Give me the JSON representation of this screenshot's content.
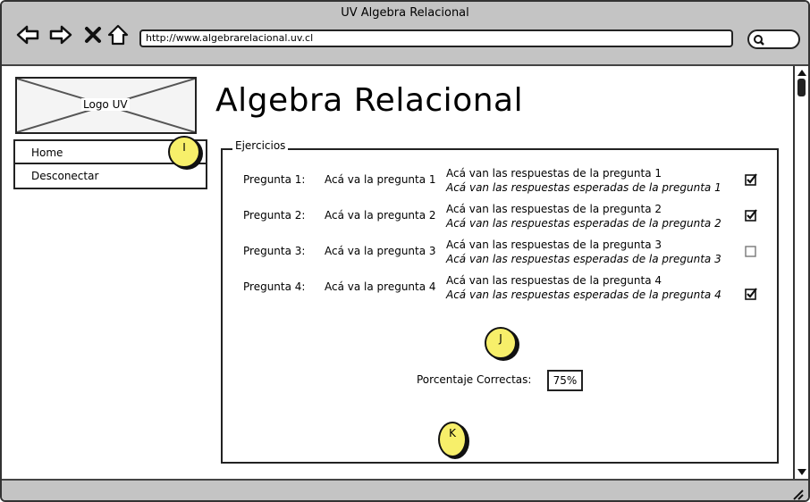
{
  "window": {
    "title": "UV Algebra Relacional"
  },
  "browser": {
    "url": "http://www.algebrarelacional.uv.cl",
    "icons": [
      "back-arrow-icon",
      "forward-arrow-icon",
      "stop-icon",
      "home-icon",
      "search-icon"
    ]
  },
  "logo": {
    "label": "Logo UV"
  },
  "sidebar": {
    "items": [
      {
        "label": "Home"
      },
      {
        "label": "Desconectar"
      }
    ]
  },
  "page": {
    "title": "Algebra Relacional"
  },
  "callouts": {
    "i": "I",
    "j": "J",
    "k": "K"
  },
  "ejercicios": {
    "legend": "Ejercicios",
    "rows": [
      {
        "label": "Pregunta 1:",
        "question": "Acá va la pregunta 1",
        "answers": "Acá van las respuestas de la pregunta 1",
        "expected": "Acá van las respuestas esperadas de la pregunta 1",
        "checked": true
      },
      {
        "label": "Pregunta 2:",
        "question": "Acá va la pregunta 2",
        "answers": "Acá van las respuestas de la pregunta 2",
        "expected": "Acá van las respuestas esperadas de la pregunta 2",
        "checked": true
      },
      {
        "label": "Pregunta 3:",
        "question": "Acá va la pregunta 3",
        "answers": "Acá van las respuestas de la pregunta 3",
        "expected": "Acá van las respuestas esperadas de la pregunta 3",
        "checked": false
      },
      {
        "label": "Pregunta 4:",
        "question": "Acá va la pregunta 4",
        "answers": "Acá van las respuestas de la pregunta 4",
        "expected": "Acá van las respuestas esperadas de la pregunta 4",
        "checked": true
      }
    ],
    "score_label": "Porcentaje Correctas:",
    "score_value": "75%"
  },
  "colors": {
    "chrome": "#c4c4c4",
    "callout": "#f7ef6a"
  }
}
